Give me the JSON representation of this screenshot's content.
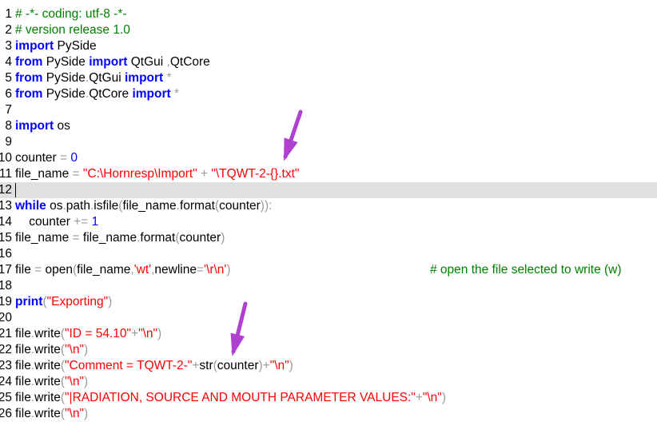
{
  "editor": {
    "lines": [
      {
        "num": "1",
        "tokens": [
          {
            "t": "# -*- coding: utf-8 -*-",
            "k": "comment"
          }
        ]
      },
      {
        "num": "2",
        "tokens": [
          {
            "t": "# version release 1.0",
            "k": "comment"
          }
        ]
      },
      {
        "num": "3",
        "tokens": [
          {
            "t": "import",
            "k": "keyword"
          },
          {
            "t": " PySide",
            "k": "ident"
          }
        ]
      },
      {
        "num": "4",
        "tokens": [
          {
            "t": "from",
            "k": "keyword"
          },
          {
            "t": " PySide ",
            "k": "ident"
          },
          {
            "t": "import",
            "k": "keyword"
          },
          {
            "t": " QtGui ",
            "k": "ident"
          },
          {
            "t": ",",
            "k": "op"
          },
          {
            "t": "QtCore",
            "k": "ident"
          }
        ]
      },
      {
        "num": "5",
        "tokens": [
          {
            "t": "from",
            "k": "keyword"
          },
          {
            "t": " PySide",
            "k": "ident"
          },
          {
            "t": ".",
            "k": "op"
          },
          {
            "t": "QtGui ",
            "k": "ident"
          },
          {
            "t": "import",
            "k": "keyword"
          },
          {
            "t": " *",
            "k": "op"
          }
        ]
      },
      {
        "num": "6",
        "tokens": [
          {
            "t": "from",
            "k": "keyword"
          },
          {
            "t": " PySide",
            "k": "ident"
          },
          {
            "t": ".",
            "k": "op"
          },
          {
            "t": "QtCore ",
            "k": "ident"
          },
          {
            "t": "import",
            "k": "keyword"
          },
          {
            "t": " *",
            "k": "op"
          }
        ]
      },
      {
        "num": "7",
        "tokens": []
      },
      {
        "num": "8",
        "tokens": [
          {
            "t": "import",
            "k": "keyword"
          },
          {
            "t": " os",
            "k": "ident"
          }
        ]
      },
      {
        "num": "9",
        "tokens": []
      },
      {
        "num": "10",
        "tokens": [
          {
            "t": "counter ",
            "k": "ident"
          },
          {
            "t": "=",
            "k": "op"
          },
          {
            "t": " 0",
            "k": "number"
          }
        ]
      },
      {
        "num": "11",
        "tokens": [
          {
            "t": "file_name ",
            "k": "ident"
          },
          {
            "t": "=",
            "k": "op"
          },
          {
            "t": " ",
            "k": "ident"
          },
          {
            "t": "\"C:\\Hornresp\\Import\"",
            "k": "string"
          },
          {
            "t": " + ",
            "k": "op"
          },
          {
            "t": "\"\\TQWT-2-{}.txt\"",
            "k": "string"
          }
        ]
      },
      {
        "num": "12",
        "tokens": [],
        "current": true
      },
      {
        "num": "13",
        "tokens": [
          {
            "t": "while",
            "k": "keyword"
          },
          {
            "t": " os",
            "k": "ident"
          },
          {
            "t": ".",
            "k": "op"
          },
          {
            "t": "path",
            "k": "ident"
          },
          {
            "t": ".",
            "k": "op"
          },
          {
            "t": "isfile",
            "k": "ident"
          },
          {
            "t": "(",
            "k": "op"
          },
          {
            "t": "file_name",
            "k": "ident"
          },
          {
            "t": ".",
            "k": "op"
          },
          {
            "t": "format",
            "k": "ident"
          },
          {
            "t": "(",
            "k": "op"
          },
          {
            "t": "counter",
            "k": "ident"
          },
          {
            "t": ")):",
            "k": "op"
          }
        ]
      },
      {
        "num": "14",
        "tokens": [
          {
            "t": "    counter ",
            "k": "ident"
          },
          {
            "t": "+=",
            "k": "op"
          },
          {
            "t": " 1",
            "k": "number"
          }
        ]
      },
      {
        "num": "15",
        "tokens": [
          {
            "t": "file_name ",
            "k": "ident"
          },
          {
            "t": "=",
            "k": "op"
          },
          {
            "t": " file_name",
            "k": "ident"
          },
          {
            "t": ".",
            "k": "op"
          },
          {
            "t": "format",
            "k": "ident"
          },
          {
            "t": "(",
            "k": "op"
          },
          {
            "t": "counter",
            "k": "ident"
          },
          {
            "t": ")",
            "k": "op"
          }
        ]
      },
      {
        "num": "16",
        "tokens": []
      },
      {
        "num": "17",
        "tokens": [
          {
            "t": "file ",
            "k": "ident"
          },
          {
            "t": "=",
            "k": "op"
          },
          {
            "t": " open",
            "k": "ident"
          },
          {
            "t": "(",
            "k": "op"
          },
          {
            "t": "file_name",
            "k": "ident"
          },
          {
            "t": ",",
            "k": "op"
          },
          {
            "t": "'wt'",
            "k": "string"
          },
          {
            "t": ",",
            "k": "op"
          },
          {
            "t": "newline",
            "k": "ident"
          },
          {
            "t": "=",
            "k": "op"
          },
          {
            "t": "'\\r\\n'",
            "k": "string"
          },
          {
            "t": ")",
            "k": "op"
          }
        ],
        "comment": "# open the file selected to write (w)"
      },
      {
        "num": "18",
        "tokens": []
      },
      {
        "num": "19",
        "tokens": [
          {
            "t": "print",
            "k": "builtin"
          },
          {
            "t": "(",
            "k": "op"
          },
          {
            "t": "\"Exporting\"",
            "k": "string"
          },
          {
            "t": ")",
            "k": "op"
          }
        ]
      },
      {
        "num": "20",
        "tokens": []
      },
      {
        "num": "21",
        "tokens": [
          {
            "t": "file",
            "k": "ident"
          },
          {
            "t": ".",
            "k": "op"
          },
          {
            "t": "write",
            "k": "ident"
          },
          {
            "t": "(",
            "k": "op"
          },
          {
            "t": "\"ID = 54.10\"",
            "k": "string"
          },
          {
            "t": "+",
            "k": "op"
          },
          {
            "t": "\"\\n\"",
            "k": "string"
          },
          {
            "t": ")",
            "k": "op"
          }
        ]
      },
      {
        "num": "22",
        "tokens": [
          {
            "t": "file",
            "k": "ident"
          },
          {
            "t": ".",
            "k": "op"
          },
          {
            "t": "write",
            "k": "ident"
          },
          {
            "t": "(",
            "k": "op"
          },
          {
            "t": "\"\\n\"",
            "k": "string"
          },
          {
            "t": ")",
            "k": "op"
          }
        ]
      },
      {
        "num": "23",
        "tokens": [
          {
            "t": "file",
            "k": "ident"
          },
          {
            "t": ".",
            "k": "op"
          },
          {
            "t": "write",
            "k": "ident"
          },
          {
            "t": "(",
            "k": "op"
          },
          {
            "t": "\"Comment = TQWT-2-\"",
            "k": "string"
          },
          {
            "t": "+",
            "k": "op"
          },
          {
            "t": "str",
            "k": "ident"
          },
          {
            "t": "(",
            "k": "op"
          },
          {
            "t": "counter",
            "k": "ident"
          },
          {
            "t": ")+",
            "k": "op"
          },
          {
            "t": "\"\\n\"",
            "k": "string"
          },
          {
            "t": ")",
            "k": "op"
          }
        ]
      },
      {
        "num": "24",
        "tokens": [
          {
            "t": "file",
            "k": "ident"
          },
          {
            "t": ".",
            "k": "op"
          },
          {
            "t": "write",
            "k": "ident"
          },
          {
            "t": "(",
            "k": "op"
          },
          {
            "t": "\"\\n\"",
            "k": "string"
          },
          {
            "t": ")",
            "k": "op"
          }
        ]
      },
      {
        "num": "25",
        "tokens": [
          {
            "t": "file",
            "k": "ident"
          },
          {
            "t": ".",
            "k": "op"
          },
          {
            "t": "write",
            "k": "ident"
          },
          {
            "t": "(",
            "k": "op"
          },
          {
            "t": "\"|RADIATION, SOURCE AND MOUTH PARAMETER VALUES:\"",
            "k": "string"
          },
          {
            "t": "+",
            "k": "op"
          },
          {
            "t": "\"\\n\"",
            "k": "string"
          },
          {
            "t": ")",
            "k": "op"
          }
        ]
      },
      {
        "num": "26",
        "tokens": [
          {
            "t": "file",
            "k": "ident"
          },
          {
            "t": ".",
            "k": "op"
          },
          {
            "t": "write",
            "k": "ident"
          },
          {
            "t": "(",
            "k": "op"
          },
          {
            "t": "\"\\n\"",
            "k": "string"
          },
          {
            "t": ")",
            "k": "op"
          }
        ]
      }
    ]
  },
  "annotations": {
    "arrow_color": "#b040d0",
    "arrows": [
      {
        "name": "annotation-arrow-line-11"
      },
      {
        "name": "annotation-arrow-line-23"
      }
    ]
  }
}
